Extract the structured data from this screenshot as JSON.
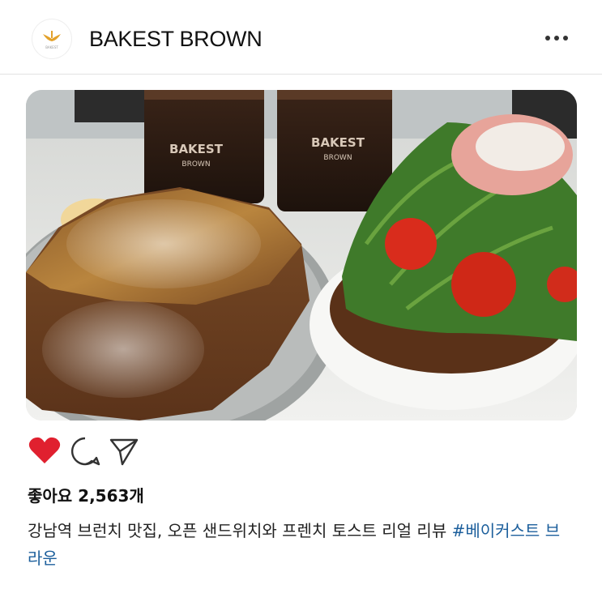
{
  "header": {
    "account_name": "BAKEST BROWN",
    "avatar_icon": "bakest-brown-logo",
    "menu_icon": "more-dots-icon"
  },
  "photo": {
    "cup_print_left": "BAKEST",
    "cup_print_left_sub": "BROWN",
    "cup_print_right": "BAKEST",
    "cup_print_right_sub": "BROWN"
  },
  "actions": {
    "like_icon": "heart-filled-icon",
    "comment_icon": "comment-icon",
    "share_icon": "send-icon",
    "like_color": "#e0202f"
  },
  "post": {
    "likes": "좋아요 2,563개",
    "caption_text": "강남역 브런치 맛집, 오픈 샌드위치와 프렌치 토스트 리얼 리뷰",
    "hashtag": "#베이커스트 브라운"
  }
}
